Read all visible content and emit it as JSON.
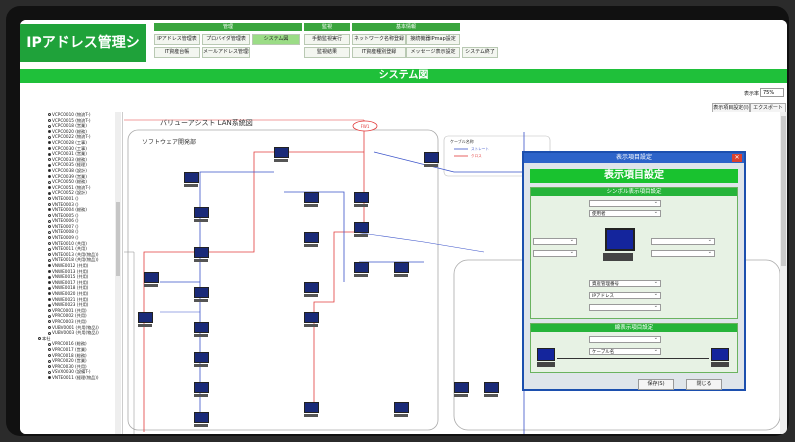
{
  "app": {
    "title": "IPアドレス管理システム"
  },
  "menu": {
    "groups": [
      {
        "title": "管理",
        "items": [
          "IPアドレス管理表",
          "プロバイダ管理表",
          "システム図",
          "IT資産台帳",
          "メールアドレス管理表"
        ]
      },
      {
        "title": "監視",
        "items": [
          "手動監視実行",
          "監視結果"
        ]
      },
      {
        "title": "基本情報",
        "items": [
          "ネットワーク名称登録",
          "接続機器IPmap設定",
          "IT資産種別登録",
          "メッセージ表示設定"
        ]
      }
    ],
    "exit_label": "システム終了",
    "active_item": "システム図"
  },
  "banner": {
    "title": "システム図"
  },
  "zoom": {
    "label": "表示率",
    "value": "75%"
  },
  "toolbar": {
    "display_settings": "表示項目設定(I)",
    "export": "エクスポート(E)"
  },
  "tree": {
    "items": [
      {
        "label": "VCPC0010 (物流T-)",
        "filled": false
      },
      {
        "label": "VCPC0015 (物流T-)",
        "filled": false
      },
      {
        "label": "VCPC0018 (営業)",
        "filled": false
      },
      {
        "label": "VCPC0020 (総務)",
        "filled": true
      },
      {
        "label": "VCPC0022 (物流T-)",
        "filled": false
      },
      {
        "label": "VCPC0028 (工事)",
        "filled": true
      },
      {
        "label": "VCPC0030 (工事)",
        "filled": true
      },
      {
        "label": "VCPC0031 (営業)",
        "filled": true
      },
      {
        "label": "VCPC0033 (総務)",
        "filled": false
      },
      {
        "label": "VCPC0035 (経理)",
        "filled": true
      },
      {
        "label": "VCPC0038 (設計)",
        "filled": true
      },
      {
        "label": "VCPC0039 (営業)",
        "filled": true
      },
      {
        "label": "VCPC0050 (総務)",
        "filled": false
      },
      {
        "label": "VCPC0051 (物流T-)",
        "filled": true
      },
      {
        "label": "VCPC0052 (設計)",
        "filled": true
      },
      {
        "label": "VNTE0001 ()",
        "filled": false
      },
      {
        "label": "VNTE0003 ()",
        "filled": false
      },
      {
        "label": "VNTE0004 (総務)",
        "filled": true
      },
      {
        "label": "VNTE0005 ()",
        "filled": false
      },
      {
        "label": "VNTE0006 ()",
        "filled": false
      },
      {
        "label": "VNTE0007 ()",
        "filled": false
      },
      {
        "label": "VNTE0008 ()",
        "filled": false
      },
      {
        "label": "VNTE0009 ()",
        "filled": false
      },
      {
        "label": "VNTE0010 (共用)",
        "filled": false
      },
      {
        "label": "VNTE0011 (共用)",
        "filled": false
      },
      {
        "label": "VNTE0013 (共用(物品))",
        "filled": false
      },
      {
        "label": "VNTE0018 (共用(物品))",
        "filled": false
      },
      {
        "label": "VNWE0012 (共用)",
        "filled": true
      },
      {
        "label": "VNWE0013 (共用)",
        "filled": true
      },
      {
        "label": "VNWE0015 (共用)",
        "filled": true
      },
      {
        "label": "VNWE0017 (共用)",
        "filled": true
      },
      {
        "label": "VNWE0018 (共用)",
        "filled": true
      },
      {
        "label": "VNWE0020 (共用)",
        "filled": true
      },
      {
        "label": "VNWE0021 (共用)",
        "filled": true
      },
      {
        "label": "VNWE0023 (共用)",
        "filled": true
      },
      {
        "label": "VPRC0001 (共用)",
        "filled": false
      },
      {
        "label": "VPRC0002 (共用)",
        "filled": false
      },
      {
        "label": "VPRC0003 (共用)",
        "filled": false
      },
      {
        "label": "VUBV0001 (共用(物品))",
        "filled": false
      },
      {
        "label": "VUBV0003 (共用(物品))",
        "filled": false
      },
      {
        "label": "本社",
        "filled": false,
        "section": true
      },
      {
        "label": "VPRC0016 (総務)",
        "filled": false
      },
      {
        "label": "VPRC0017 (営業)",
        "filled": false
      },
      {
        "label": "VPRC0018 (総務)",
        "filled": false
      },
      {
        "label": "VPRC0020 (営業)",
        "filled": false
      },
      {
        "label": "VPRC0030 (共用)",
        "filled": false
      },
      {
        "label": "VSVX0030 (設備T-)",
        "filled": false
      },
      {
        "label": "VNTE0011 (経理(物品))",
        "filled": true
      }
    ]
  },
  "diagram": {
    "title": "バリューアシスト LAN系統図",
    "group_label": "ソフトウェア開発部",
    "legend": {
      "title": "ケーブル名称",
      "items": [
        "ストレート",
        "クロス"
      ]
    },
    "router_label": "FW1"
  },
  "dialog": {
    "window_title": "表示項目設定",
    "heading": "表示項目設定",
    "symbol_section": "シンボル表示項目設定",
    "line_section": "線表示項目設定",
    "selects": {
      "symbol_top1": "",
      "symbol_top2": "使用者",
      "symbol_left1": "",
      "symbol_left2": "",
      "symbol_right1": "",
      "symbol_right2": "",
      "symbol_bottom1": "資産管理番号",
      "symbol_bottom2": "IPアドレス",
      "symbol_bottom3": "",
      "line_top": "",
      "line_bottom": "ケーブル名"
    },
    "save_label": "保存(S)",
    "close_label": "閉じる"
  },
  "colors": {
    "brand_green": "#1fa23a",
    "banner_green": "#1fc03a",
    "dialog_blue": "#2c63c9",
    "link_red": "#e23c3c",
    "link_blue": "#3a52c9"
  }
}
